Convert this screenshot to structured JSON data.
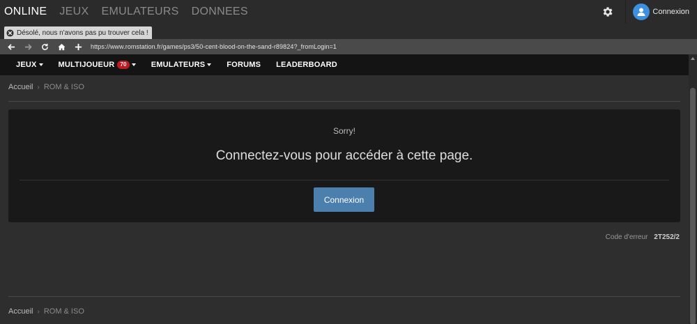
{
  "topbar": {
    "tabs": [
      "ONLINE",
      "JEUX",
      "EMULATEURS",
      "DONNEES"
    ],
    "active_tab": "ONLINE",
    "settings_icon": "gear-icon",
    "avatar_icon": "user-icon",
    "login_label": "Connexion",
    "avatar_color": "#3d8fe0"
  },
  "browser": {
    "tab_title": "Désolé, nous n'avons pas pu trouver cela !",
    "url": "https://www.romstation.fr/games/ps3/50-cent-blood-on-the-sand-r89824?_fromLogin=1",
    "nav_icons": [
      "back-arrow-icon",
      "forward-arrow-icon",
      "reload-icon",
      "home-icon",
      "new-tab-icon"
    ]
  },
  "sitenav": {
    "items": [
      {
        "label": "JEUX",
        "dropdown": true
      },
      {
        "label": "MULTIJOUEUR",
        "badge": "70",
        "dropdown": true
      },
      {
        "label": "EMULATEURS",
        "dropdown": true
      },
      {
        "label": "FORUMS",
        "dropdown": false
      },
      {
        "label": "LEADERBOARD",
        "dropdown": false
      }
    ],
    "badge_color": "#c0191e"
  },
  "breadcrumb": {
    "home": "Accueil",
    "section": "ROM & ISO"
  },
  "error_panel": {
    "sorry": "Sorry!",
    "message": "Connectez-vous pour accéder à cette page.",
    "button_label": "Connexion",
    "button_color": "#4a7fae"
  },
  "error_code": {
    "label": "Code d'erreur",
    "code": "2T252/2"
  }
}
